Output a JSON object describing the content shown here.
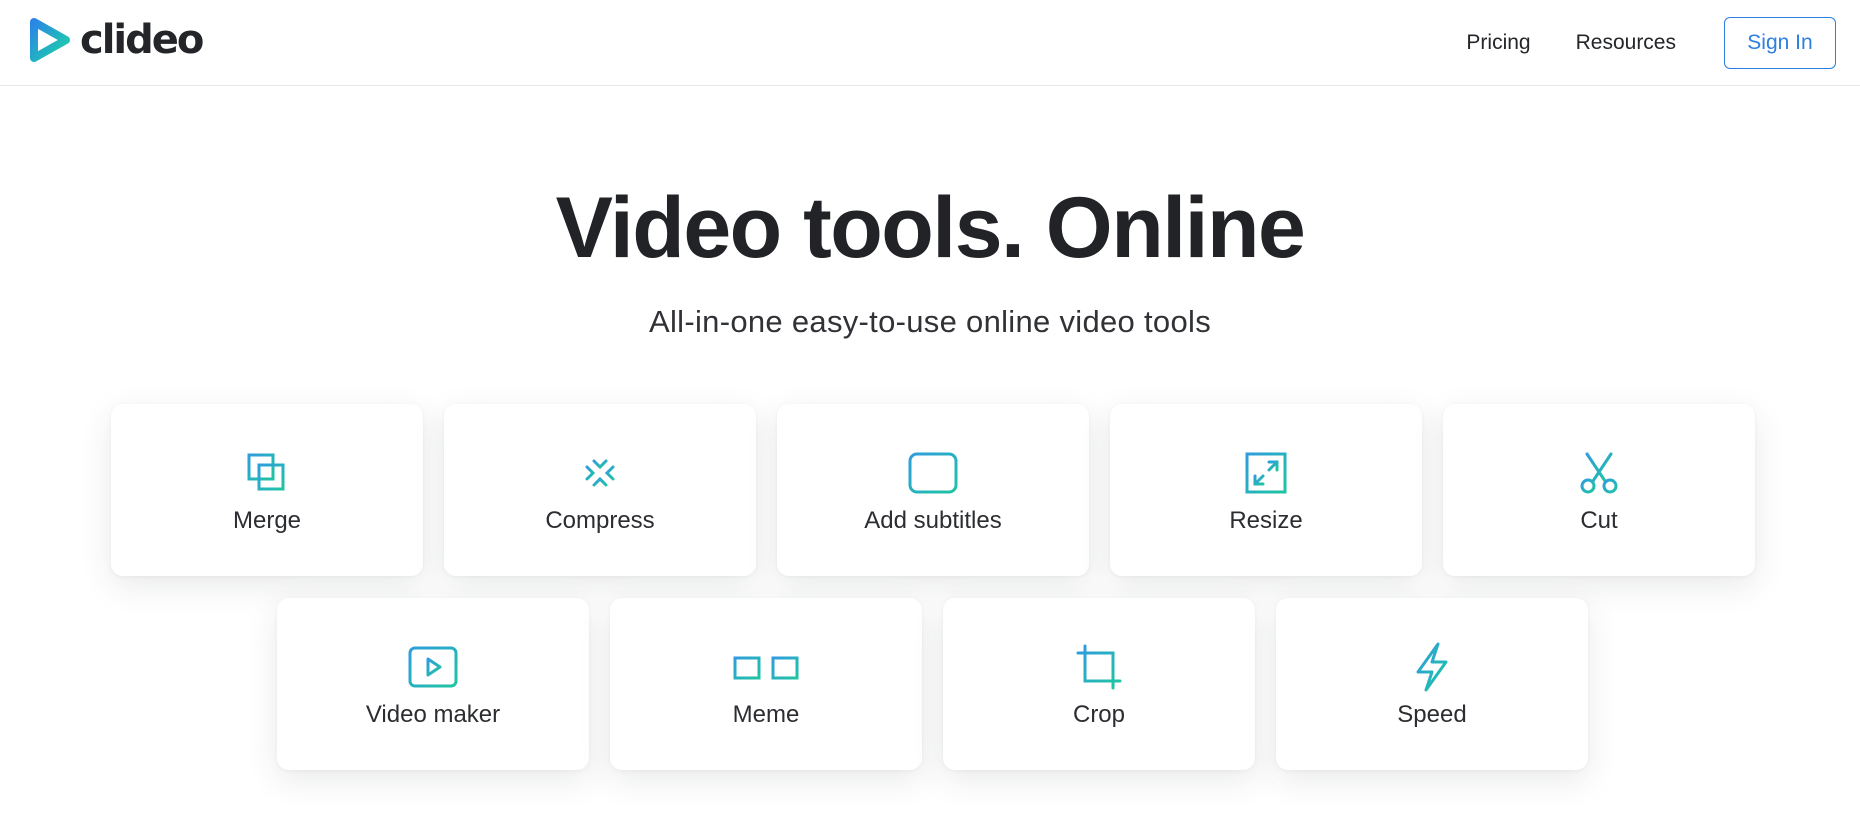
{
  "brand": {
    "name": "clideo"
  },
  "nav": {
    "pricing": "Pricing",
    "resources": "Resources",
    "sign_in": "Sign In"
  },
  "hero": {
    "title": "Video tools. Online",
    "subtitle": "All-in-one easy-to-use online video tools"
  },
  "tools": [
    {
      "label": "Merge",
      "icon": "merge-icon"
    },
    {
      "label": "Compress",
      "icon": "compress-icon"
    },
    {
      "label": "Add subtitles",
      "icon": "subtitles-icon"
    },
    {
      "label": "Resize",
      "icon": "resize-icon"
    },
    {
      "label": "Cut",
      "icon": "scissors-icon"
    },
    {
      "label": "Video maker",
      "icon": "play-icon"
    },
    {
      "label": "Meme",
      "icon": "glasses-icon"
    },
    {
      "label": "Crop",
      "icon": "crop-icon"
    },
    {
      "label": "Speed",
      "icon": "lightning-icon"
    }
  ],
  "colors": {
    "accent_blue": "#2d7fe0",
    "icon_gradient_start": "#2f9fdc",
    "icon_gradient_end": "#1fc3a4",
    "text_dark": "#222326"
  }
}
